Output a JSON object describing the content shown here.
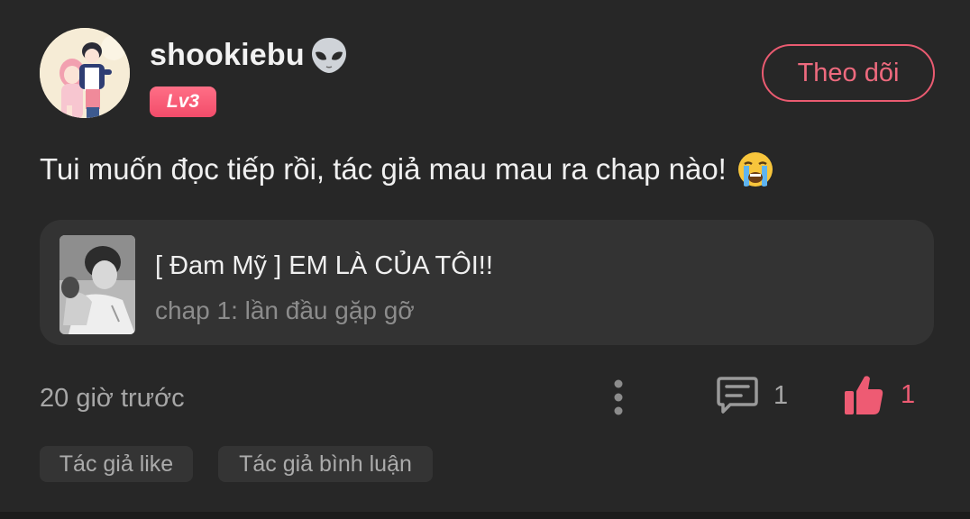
{
  "post": {
    "username": "shookiebu",
    "username_icon": "alien-icon",
    "level_badge": "Lv3",
    "follow_button_label": "Theo dõi",
    "comment_text": "Tui muốn đọc tiếp rồi, tác giả mau mau ra chap nào!",
    "comment_emoji": "loudly-crying-face-icon"
  },
  "story": {
    "title": "[ Đam Mỹ ] EM LÀ CỦA TÔI!!",
    "chapter": "chap 1: lần đầu gặp gỡ"
  },
  "footer": {
    "timestamp": "20 giờ trước",
    "reply_count": "1",
    "like_count": "1",
    "tags": [
      "Tác giả like",
      "Tác giả bình luận"
    ]
  },
  "colors": {
    "background": "#272727",
    "accent": "#ee5b73",
    "story_box": "#333333",
    "tag_bg": "#343434"
  }
}
